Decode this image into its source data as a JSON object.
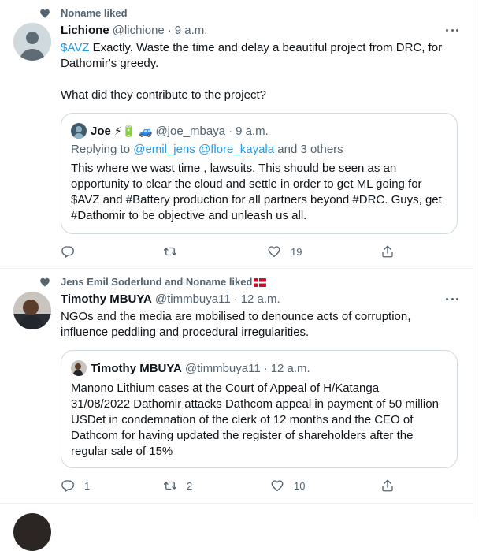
{
  "tweets": [
    {
      "social_context": "Noname liked",
      "author": {
        "name": "Lichione",
        "handle": "@lichione",
        "time": "9 a.m."
      },
      "text_link": "$AVZ",
      "text_line1": " Exactly. Waste the time and delay a beautiful project from DRC, for",
      "text_line2": "Dathomir's greedy.",
      "text_line3": "What did they contribute to the project?",
      "quote": {
        "name": "Joe",
        "emojis": "⚡🔋 🚙",
        "handle": "@joe_mbaya",
        "time": "9 a.m.",
        "replying_prefix": "Replying to ",
        "replying_users": "@emil_jens @flore_kayala",
        "replying_suffix": " and 3 others",
        "lines": [
          "This where we wast time , lawsuits. This should be seen as an",
          "opportunity to clear the cloud and settle in order to get ML going for",
          "$AVZ and #Battery production for all partners beyond #DRC. Guys, get",
          "#Dathomir to be objective and unleash us all."
        ]
      },
      "actions": {
        "reply_count": "",
        "retweet_count": "",
        "like_count": "19"
      }
    },
    {
      "social_context": "Jens Emil Soderlund  and Noname liked",
      "author": {
        "name": "Timothy MBUYA",
        "handle": "@timmbuya11",
        "time": "12 a.m."
      },
      "text_line1": "NGOs and the media are mobilised to denounce acts of corruption,",
      "text_line2": "influence peddling and procedural irregularities.",
      "quote": {
        "name": "Timothy MBUYA",
        "handle": "@timmbuya11",
        "time": "12 a.m.",
        "lines": [
          "Manono Lithium cases at the Court of Appeal of H/Katanga",
          "31/08/2022 Dathomir attacks Dathcom appeal in payment of 50 million",
          "USDet in condemnation of the clerk of 12 months and the CEO of",
          "Dathcom for having updated the register of shareholders after the",
          "regular sale of 15%"
        ]
      },
      "actions": {
        "reply_count": "1",
        "retweet_count": "2",
        "like_count": "10"
      }
    }
  ],
  "separator": "·",
  "icons": {
    "social": "heart-icon",
    "more": "more-icon",
    "reply": "reply-icon",
    "retweet": "retweet-icon",
    "like": "like-icon",
    "share": "share-icon"
  },
  "colors": {
    "link": "#1d9bf0",
    "secondary": "#536471",
    "border": "#cfd9de",
    "text": "#0f1419"
  }
}
